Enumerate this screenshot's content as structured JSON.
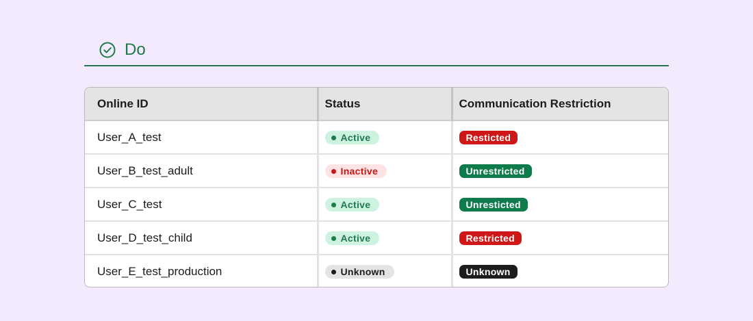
{
  "header": {
    "title": "Do",
    "icon": "check-circle-icon",
    "accent_color": "#1e7a4a"
  },
  "table": {
    "columns": [
      "Online ID",
      "Status",
      "Communication Restriction"
    ],
    "rows": [
      {
        "online_id": "User_A_test",
        "status": "Active",
        "status_kind": "active",
        "restriction": "Resticted",
        "restriction_color": "#cf1717"
      },
      {
        "online_id": "User_B_test_adult",
        "status": "Inactive",
        "status_kind": "inactive",
        "restriction": "Unrestricted",
        "restriction_color": "#0f7a4a"
      },
      {
        "online_id": "User_C_test",
        "status": "Active",
        "status_kind": "active",
        "restriction": "Unresticted",
        "restriction_color": "#0f7a4a"
      },
      {
        "online_id": "User_D_test_child",
        "status": "Active",
        "status_kind": "active",
        "restriction": "Restricted",
        "restriction_color": "#cf1717"
      },
      {
        "online_id": "User_E_test_production",
        "status": "Unknown",
        "status_kind": "unknown",
        "restriction": "Unknown",
        "restriction_color": "#1c1c1c"
      }
    ]
  }
}
